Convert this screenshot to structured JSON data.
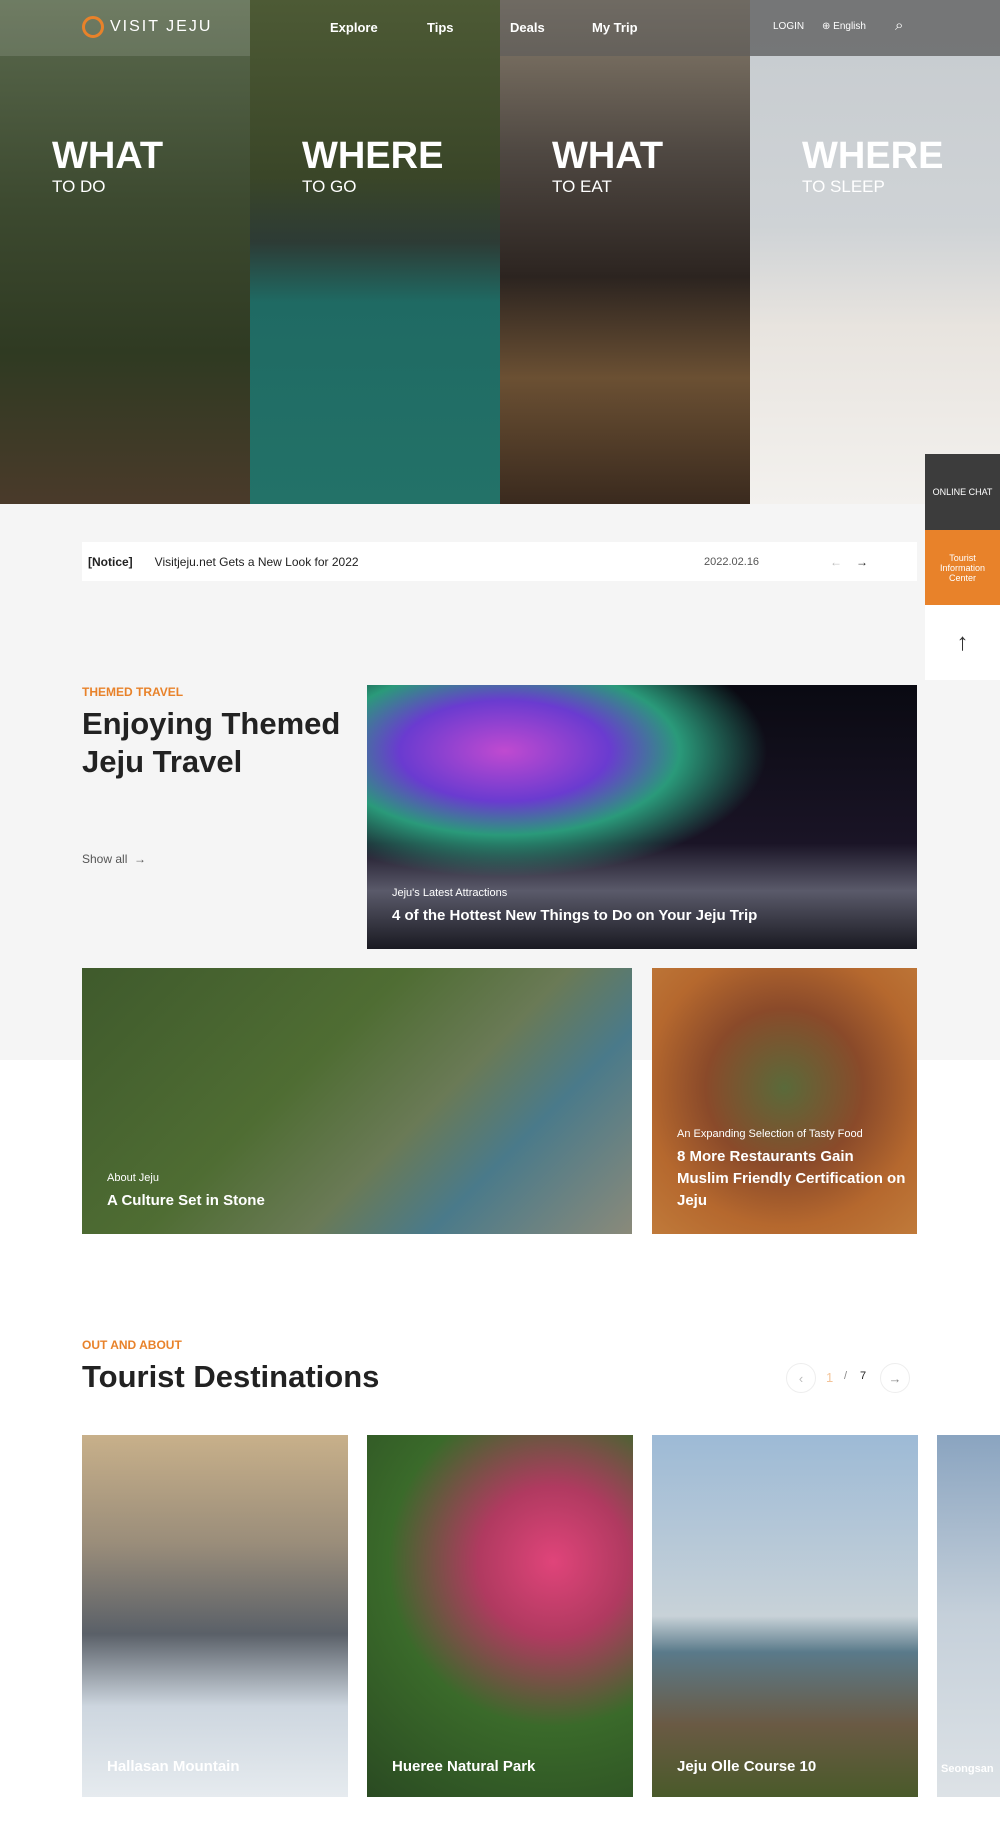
{
  "nav": {
    "logo": "VISIT JEJU",
    "links": [
      "Explore",
      "Tips",
      "Deals",
      "My Trip"
    ],
    "login": "LOGIN",
    "language": "English"
  },
  "hero": [
    {
      "big": "WHAT",
      "small": "TO DO"
    },
    {
      "big": "WHERE",
      "small": "TO GO"
    },
    {
      "big": "WHAT",
      "small": "TO EAT"
    },
    {
      "big": "WHERE",
      "small": "TO SLEEP"
    }
  ],
  "notice": {
    "tag": "[Notice]",
    "text": "Visitjeju.net Gets a New Look for 2022",
    "date": "2022.02.16"
  },
  "side": {
    "chat": "ONLINE CHAT",
    "info": "Tourist Information Center"
  },
  "themed": {
    "label": "THEMED TRAVEL",
    "title": "Enjoying Themed Jeju Travel",
    "show_all": "Show all",
    "items": [
      {
        "sub": "Jeju's Latest Attractions",
        "title": "4 of the Hottest New Things to Do on Your Jeju Trip"
      },
      {
        "sub": "About Jeju",
        "title": "A Culture Set in Stone"
      },
      {
        "sub": "An Expanding Selection of Tasty Food",
        "title": "8 More Restaurants Gain Muslim Friendly Certification on Jeju"
      }
    ]
  },
  "destinations": {
    "label": "OUT AND ABOUT",
    "title": "Tourist Destinations",
    "page": "1",
    "sep": "/",
    "total": "7",
    "cards": [
      "Hallasan Mountain",
      "Hueree Natural Park",
      "Jeju Olle Course 10",
      "Seongsan"
    ]
  },
  "colors": {
    "accent": "#e8822a"
  }
}
